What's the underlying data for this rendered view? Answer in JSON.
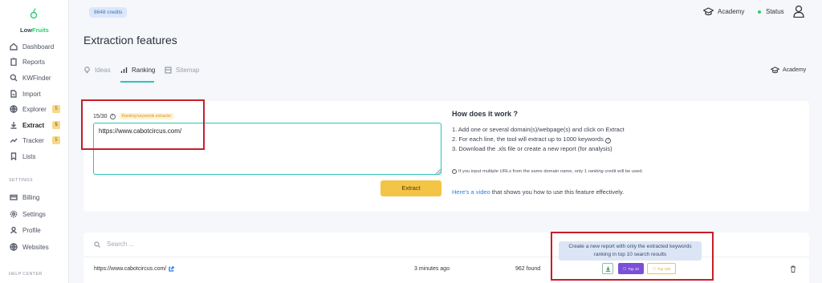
{
  "app": {
    "brand_low": "Low",
    "brand_fruits": "Fruits",
    "credits": "8648 credits"
  },
  "sidebar": {
    "items": [
      {
        "label": "Dashboard",
        "icon": "dashboard-icon",
        "badge": ""
      },
      {
        "label": "Reports",
        "icon": "clipboard-icon",
        "badge": ""
      },
      {
        "label": "KWFinder",
        "icon": "search-icon",
        "badge": ""
      },
      {
        "label": "Import",
        "icon": "file-icon",
        "badge": ""
      },
      {
        "label": "Explorer",
        "icon": "globe-icon",
        "badge": "5"
      },
      {
        "label": "Extract",
        "icon": "download-icon",
        "badge": "5"
      },
      {
        "label": "Tracker",
        "icon": "trend-icon",
        "badge": "5"
      },
      {
        "label": "Lists",
        "icon": "bookmark-icon",
        "badge": ""
      }
    ],
    "settings_label": "SETTINGS",
    "settings_items": [
      {
        "label": "Billing",
        "icon": "card-icon"
      },
      {
        "label": "Settings",
        "icon": "gear-icon"
      },
      {
        "label": "Profile",
        "icon": "user-icon"
      },
      {
        "label": "Websites",
        "icon": "globe-icon"
      }
    ],
    "help_label": "HELP CENTER"
  },
  "header": {
    "academy": "Academy",
    "status": "Status"
  },
  "page": {
    "title": "Extraction features",
    "tabs": [
      {
        "label": "Ideas",
        "active": false
      },
      {
        "label": "Ranking",
        "active": true
      },
      {
        "label": "Sitemap",
        "active": false
      }
    ],
    "academy_link": "Academy"
  },
  "extractor": {
    "counter": "15/30",
    "tag": "Ranking keywords extractor",
    "input_value": "https://www.cabotcircus.com/",
    "extract_button": "Extract"
  },
  "help": {
    "title": "How does it work ?",
    "steps": [
      "1. Add one or several domain(s)/webpage(s) and click on Extract",
      "2. For each line, the tool will extract up to 1000 keywords",
      "3. Download the .xls file or create a new report (for analysis)"
    ],
    "note_prefix": "If you input multiple URLs from the same domain name, only 1 ",
    "note_italic": "ranking",
    "note_suffix": " credit will be used.",
    "video_link": "Here's a video",
    "video_text": " that shows you how to use this feature effectively."
  },
  "results": {
    "search_placeholder": "Search ...",
    "tooltip_line1": "Create a new report with only the extracted keywords",
    "tooltip_line2": "ranking in top 10 search results",
    "rows": [
      {
        "url": "https://www.cabotcircus.com/",
        "time": "3 minutes ago",
        "found": "962 found"
      }
    ],
    "top10_label": "Top 10",
    "top100_label": "Top 100"
  },
  "colors": {
    "accent": "#2ec4b6",
    "extract_button": "#f3c445",
    "annotation_red": "#c81e2a",
    "top10": "#7b4fd6"
  }
}
